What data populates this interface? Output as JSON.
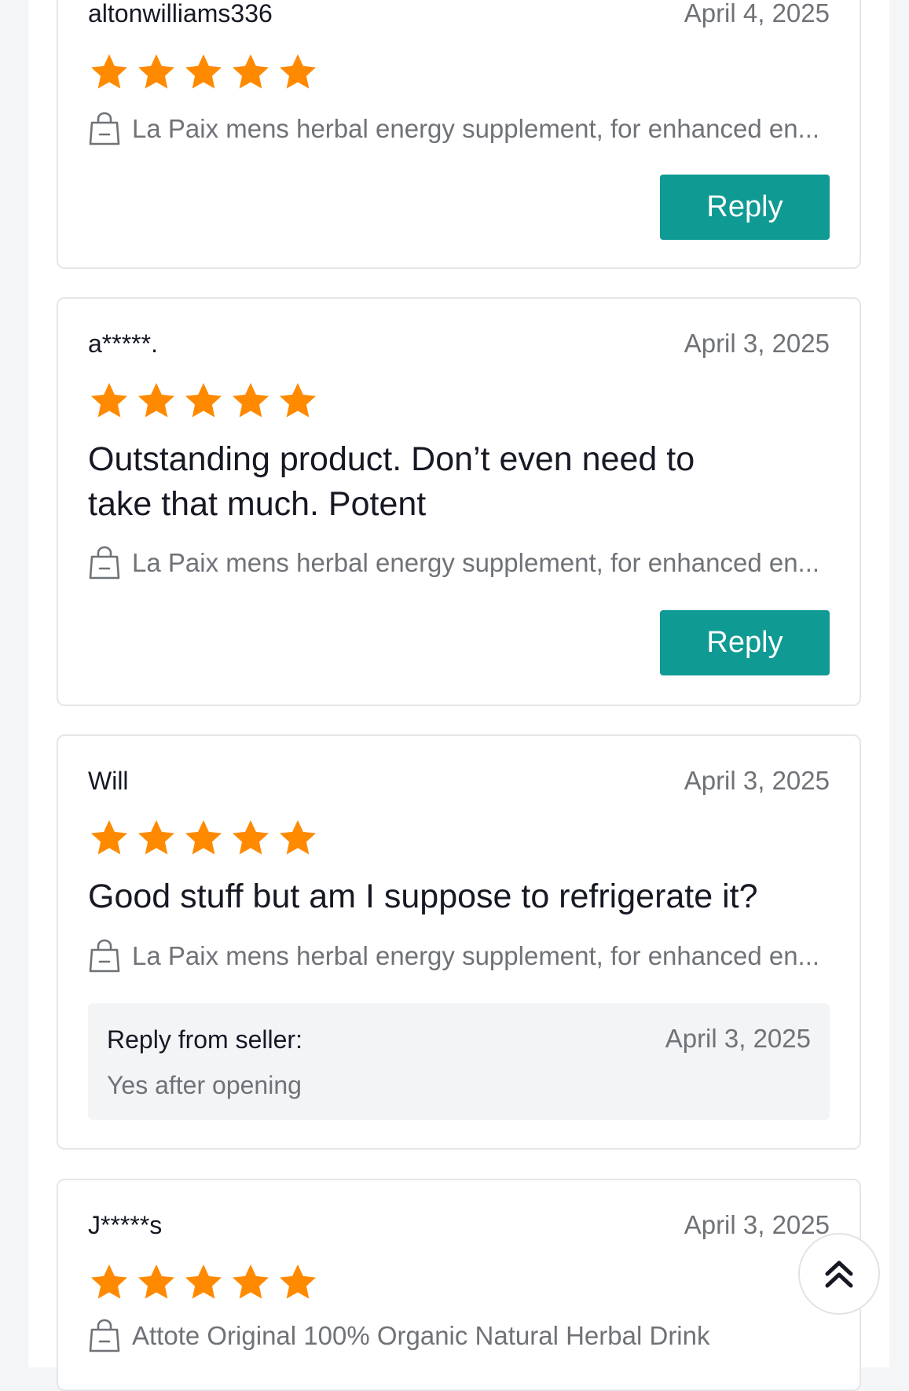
{
  "reviews": [
    {
      "username": "altonwilliams336",
      "date": "April 4, 2025",
      "rating": 5,
      "product": "La Paix mens herbal energy supplement, for enhanced en...",
      "reply_label": "Reply"
    },
    {
      "username": "a*****.",
      "date": "April 3, 2025",
      "rating": 5,
      "text_line1": "Outstanding product. Don’t even need to",
      "text_line2": "take that much. Potent",
      "product": "La Paix mens herbal energy supplement, for enhanced en...",
      "reply_label": "Reply"
    },
    {
      "username": "Will",
      "date": "April 3, 2025",
      "rating": 5,
      "text_line1": "Good stuff but am I suppose to refrigerate it?",
      "product": "La Paix mens herbal energy supplement, for enhanced en...",
      "seller_reply": {
        "label": "Reply from seller:",
        "date": "April 3, 2025",
        "text": "Yes after opening"
      }
    },
    {
      "username": "J*****s",
      "date": "April 3, 2025",
      "rating": 5,
      "product": "Attote Original 100% Organic Natural Herbal Drink"
    }
  ],
  "icons": {
    "star": "star-icon",
    "product": "shopping-bag-icon",
    "back_to_top": "double-chevron-up-icon"
  },
  "colors": {
    "star": "#ff8a00",
    "reply_button": "#0f9a93",
    "secondary_text": "#6f7277",
    "seller_box": "#f3f4f6"
  }
}
